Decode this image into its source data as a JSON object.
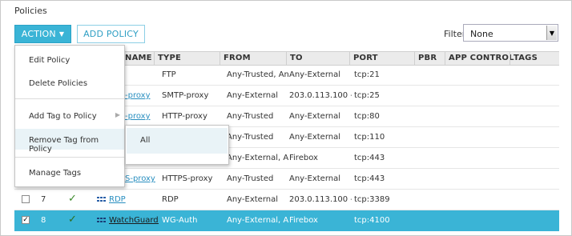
{
  "section_title": "Policies",
  "toolbar": {
    "action_label": "ACTION",
    "add_policy_label": "ADD POLICY",
    "filter_label": "Filter",
    "filter_value": "None"
  },
  "table": {
    "headers": {
      "name": "NAME",
      "type": "TYPE",
      "from": "FROM",
      "to": "TO",
      "port": "PORT",
      "pbr": "PBR",
      "app_control": "APP CONTROL",
      "tags": "TAGS"
    },
    "rows": [
      {
        "num": "",
        "name": "",
        "type": "FTP",
        "from": "Any-Trusted, Any",
        "to": "Any-External",
        "port": "tcp:21"
      },
      {
        "num": "",
        "name": "-proxy",
        "type": "SMTP-proxy",
        "from": "Any-External",
        "to": "203.0.113.100 --",
        "port": "tcp:25"
      },
      {
        "num": "",
        "name": "-proxy",
        "type": "HTTP-proxy",
        "from": "Any-Trusted",
        "to": "Any-External",
        "port": "tcp:80"
      },
      {
        "num": "",
        "name": "",
        "type": "",
        "from": "Any-Trusted",
        "to": "Any-External",
        "port": "tcp:110"
      },
      {
        "num": "",
        "name": "",
        "type": "",
        "from": "Any-External, Ar",
        "to": "Firebox",
        "port": "tcp:443"
      },
      {
        "num": "",
        "name": "S-proxy",
        "type": "HTTPS-proxy",
        "from": "Any-Trusted",
        "to": "Any-External",
        "port": "tcp:443"
      },
      {
        "num": "7",
        "name": "RDP",
        "type": "RDP",
        "from": "Any-External",
        "to": "203.0.113.100 --",
        "port": "tcp:3389"
      },
      {
        "num": "8",
        "name": "WatchGuard A",
        "type": "WG-Auth",
        "from": "Any-External, Ar",
        "to": "Firebox",
        "port": "tcp:4100"
      }
    ]
  },
  "menu": {
    "edit_policy": "Edit Policy",
    "delete_policies": "Delete Policies",
    "add_tag": "Add Tag to Policy",
    "remove_tag": "Remove Tag from Policy",
    "manage_tags": "Manage Tags"
  },
  "submenu": {
    "all": "All"
  },
  "colors": {
    "accent": "#3ab4d6",
    "link": "#2a8fc0",
    "check": "#3a8a2a"
  }
}
